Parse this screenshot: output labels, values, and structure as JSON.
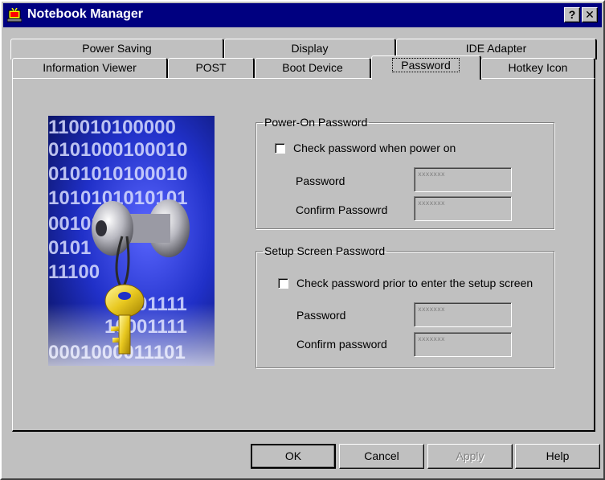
{
  "window": {
    "title": "Notebook Manager",
    "help_button": "?",
    "close_button": "✕"
  },
  "tabs": {
    "row_top": [
      "Power Saving",
      "Display",
      "IDE Adapter"
    ],
    "row_bottom": [
      "Information Viewer",
      "POST",
      "Boot Device",
      "Password",
      "Hotkey Icon"
    ],
    "active": "Password"
  },
  "image": {
    "binary_lines": [
      "110010100000",
      "0101000100010",
      "0101010100010",
      "1010101010101",
      "001010001010",
      "0101",
      "11100",
      "01111",
      "10001111",
      "0001000011101"
    ]
  },
  "power_on": {
    "legend": "Power-On Password",
    "checkbox_label": "Check password when power on",
    "checked": false,
    "password_label": "Password",
    "password_value": "xxxxxxx",
    "confirm_label": "Confirm Passowrd",
    "confirm_value": "xxxxxxx"
  },
  "setup_screen": {
    "legend": "Setup Screen Password",
    "checkbox_label": "Check password prior to enter the setup screen",
    "checked": false,
    "password_label": "Password",
    "password_value": "xxxxxxx",
    "confirm_label": "Confirm password",
    "confirm_value": "xxxxxxx"
  },
  "buttons": {
    "ok": "OK",
    "cancel": "Cancel",
    "apply": "Apply",
    "help": "Help"
  },
  "colors": {
    "titlebar": "#000080",
    "face": "#c0c0c0"
  }
}
